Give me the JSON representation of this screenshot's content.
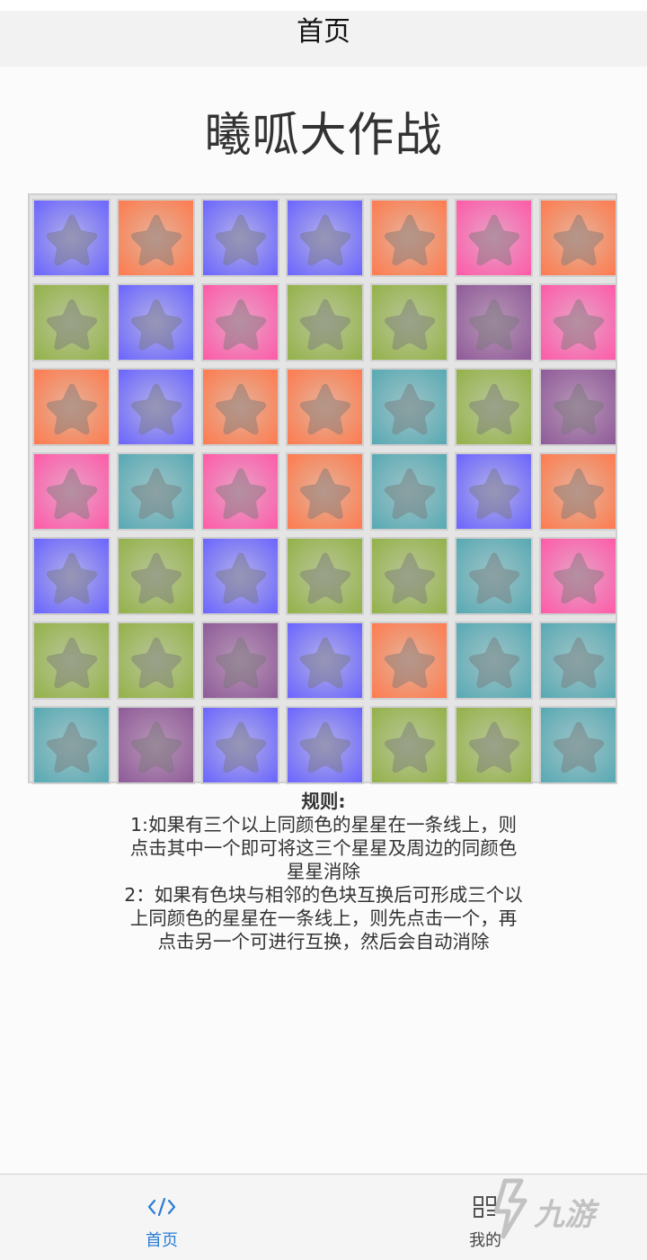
{
  "header": {
    "title": "首页"
  },
  "game": {
    "title": "曦呱大作战"
  },
  "board": {
    "rows": 7,
    "cols": 7,
    "colors": {
      "blue": "#8a86f2",
      "orange": "#f19470",
      "pink": "#f27bb6",
      "green": "#a5bb6d",
      "purple": "#a176a6",
      "teal": "#79b5bc"
    },
    "tiles": [
      [
        "blue",
        "orange",
        "blue",
        "blue",
        "orange",
        "pink",
        "orange"
      ],
      [
        "green",
        "blue",
        "pink",
        "green",
        "green",
        "purple",
        "pink"
      ],
      [
        "orange",
        "blue",
        "orange",
        "orange",
        "teal",
        "green",
        "purple"
      ],
      [
        "pink",
        "teal",
        "pink",
        "orange",
        "teal",
        "blue",
        "orange"
      ],
      [
        "blue",
        "green",
        "blue",
        "green",
        "green",
        "teal",
        "pink"
      ],
      [
        "green",
        "green",
        "purple",
        "blue",
        "orange",
        "teal",
        "teal"
      ],
      [
        "teal",
        "purple",
        "blue",
        "blue",
        "green",
        "green",
        "teal"
      ]
    ],
    "tile_icon": "star-icon"
  },
  "rules": {
    "title": "规则:",
    "text": "1:如果有三个以上同颜色的星星在一条线上，则\n点击其中一个即可将这三个星星及周边的同颜色\n星星消除\n2：如果有色块与相邻的色块互换后可形成三个以\n上同颜色的星星在一条线上，则先点击一个，再\n点击另一个可进行互换，然后会自动消除"
  },
  "tabbar": {
    "home": {
      "label": "首页",
      "icon": "code-icon",
      "color": "#2b7cd3"
    },
    "mine": {
      "label": "我的",
      "icon": "grid-icon"
    }
  },
  "watermark": {
    "text": "九游",
    "icon": "jiuyou-logo"
  }
}
